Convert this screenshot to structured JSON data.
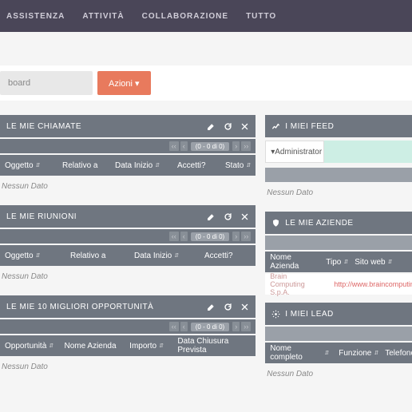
{
  "nav": {
    "items": [
      "ASSISTENZA",
      "ATTIVITÀ",
      "COLLABORAZIONE",
      "TUTTO"
    ]
  },
  "toolbar": {
    "search_placeholder": "board",
    "action_label": "Azioni ▾"
  },
  "pager": {
    "range": "(0 - 0 di 0)"
  },
  "no_data": "Nessun Dato",
  "panels": {
    "calls": {
      "title": "LE MIE CHIAMATE",
      "cols": [
        "Oggetto",
        "Relativo a",
        "Data Inizio",
        "Accetti?",
        "Stato"
      ]
    },
    "meetings": {
      "title": "LE MIE RIUNIONI",
      "cols": [
        "Oggetto",
        "Relativo a",
        "Data Inizio",
        "Accetti?"
      ]
    },
    "opps": {
      "title": "LE MIE 10 MIGLIORI OPPORTUNITÀ",
      "cols": [
        "Opportunità",
        "Nome Azienda",
        "Importo",
        "Data Chiusura Prevista"
      ]
    },
    "feed": {
      "title": "I MIEI FEED",
      "admin": "Administrator"
    },
    "companies": {
      "title": "LE MIE AZIENDE",
      "cols": [
        "Nome Azienda",
        "Tipo",
        "Sito web"
      ],
      "row": {
        "name": "Brain Computing S.p.A.",
        "site": "http://www.braincomputing.com"
      }
    },
    "leads": {
      "title": "I MIEI LEAD",
      "cols": [
        "Nome completo",
        "Funzione",
        "Telefono"
      ]
    }
  }
}
